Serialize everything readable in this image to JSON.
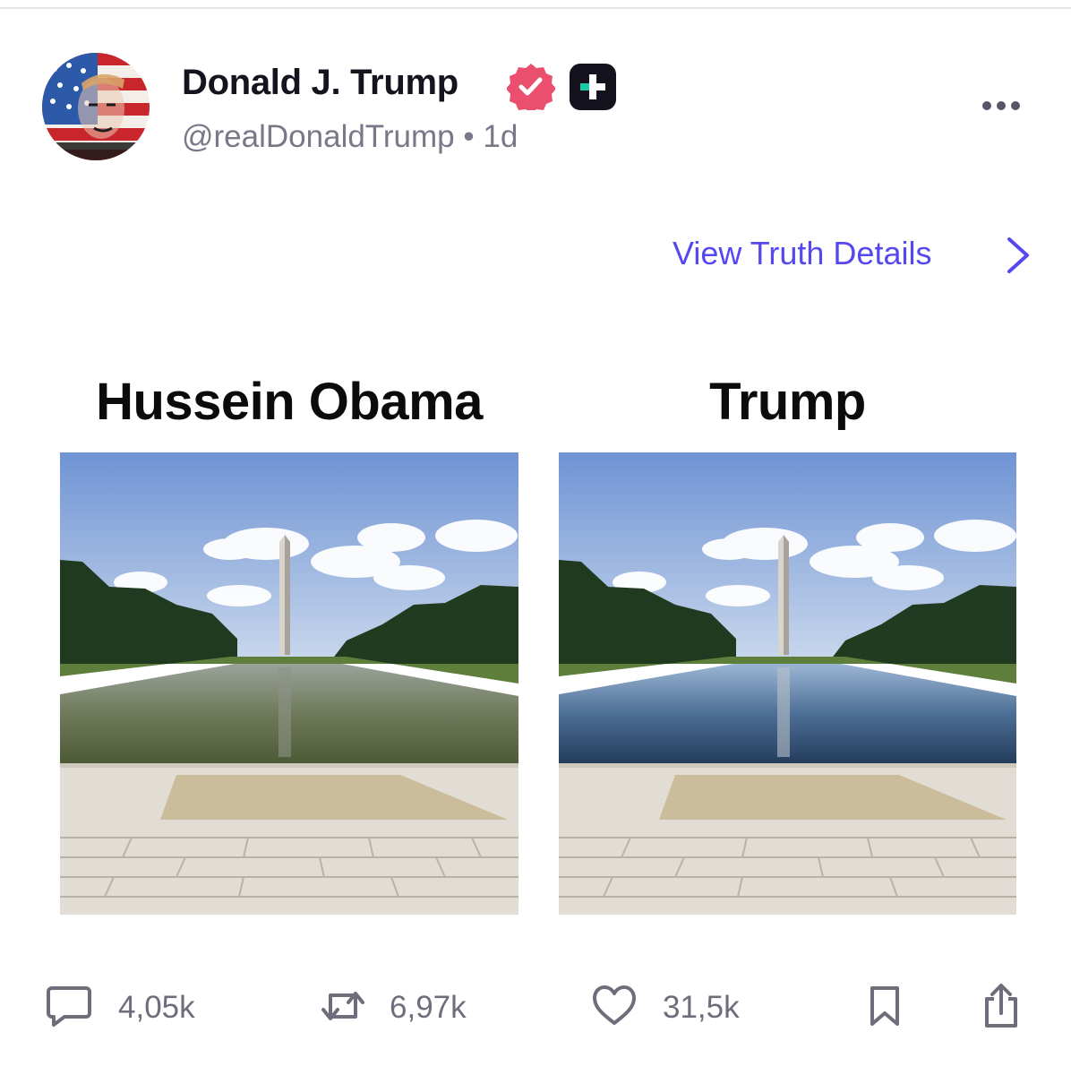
{
  "post": {
    "author": {
      "display_name": "Donald J. Trump",
      "handle": "@realDonaldTrump",
      "separator": "•",
      "time_ago": "1d"
    },
    "icons": {
      "avatar": "avatar-image",
      "verified": "verified-badge-icon",
      "plus": "plus-badge-icon",
      "more": "more-options-icon"
    },
    "view_details_label": "View Truth Details",
    "media": {
      "left_label": "Hussein Obama",
      "right_label": "Trump"
    },
    "actions": {
      "replies": "4,05k",
      "retruths": "6,97k",
      "likes": "31,5k"
    }
  },
  "colors": {
    "accent": "#5448ee",
    "verified": "#ea4f6e",
    "muted_text": "#7a7788",
    "plus_badge_bg": "#14121d",
    "plus_badge_cross": "#20c9a6"
  }
}
